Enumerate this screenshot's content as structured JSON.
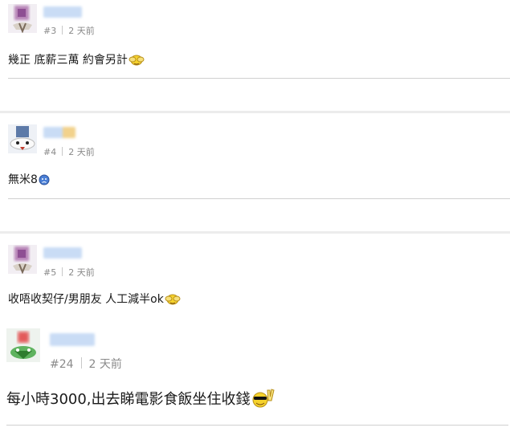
{
  "posts": [
    {
      "floor": "#3",
      "time": "2 天前",
      "content": "幾正 底薪三萬 約會另計",
      "emoji": "hands-over-face-emoji"
    },
    {
      "floor": "#4",
      "time": "2 天前",
      "content": "無米8",
      "emoji": "sad-face-emoji"
    },
    {
      "floor": "#5",
      "time": "2 天前",
      "content": "收唔收契仔/男朋友 人工減半ok",
      "emoji": "hands-over-face-emoji"
    },
    {
      "floor": "#24",
      "time": "2 天前",
      "content": "每小時3000,出去睇電影食飯坐住收錢",
      "emoji": "cool-victory-emoji"
    }
  ],
  "colors": {
    "meta": "#8a8a8a",
    "divider": "#d0d0d0",
    "band": "#ececec",
    "name_blur": "#c9dcf5"
  }
}
